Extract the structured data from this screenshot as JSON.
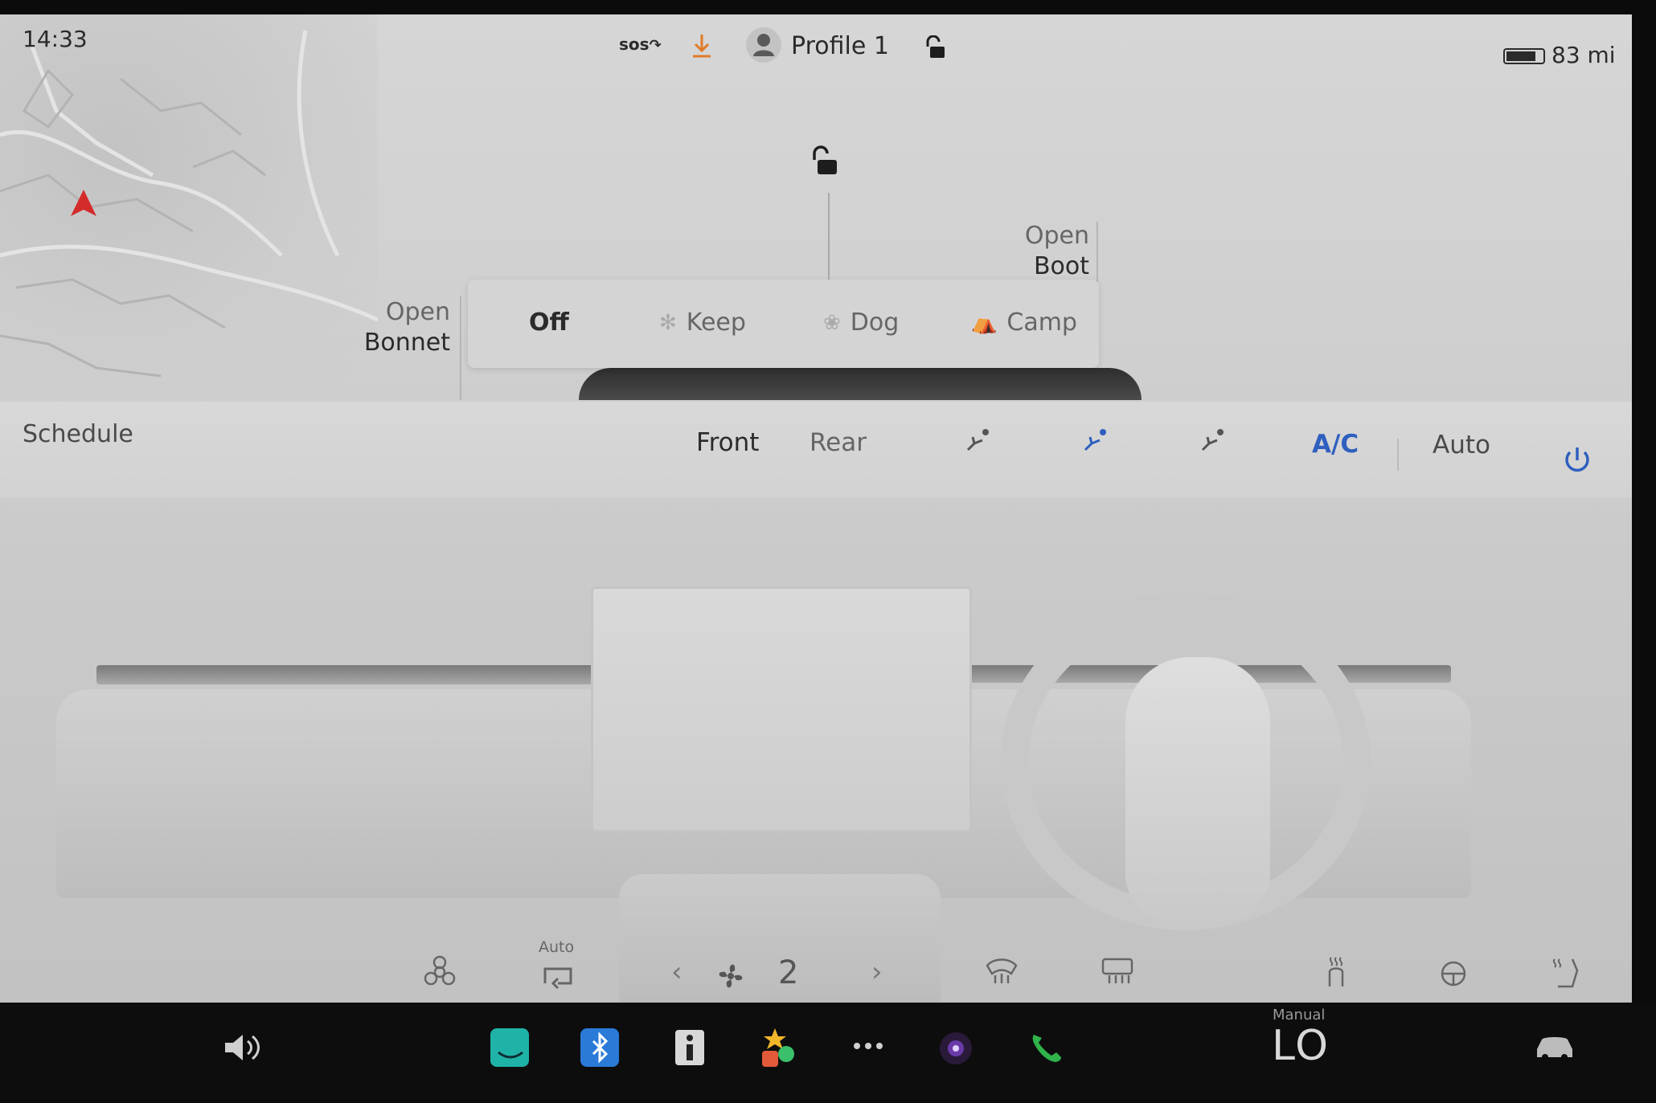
{
  "status": {
    "time": "14:33",
    "sos_label": "sos",
    "profile_name": "Profile 1",
    "range": "83 mi"
  },
  "car": {
    "open_bonnet_line1": "Open",
    "open_bonnet_line2": "Bonnet",
    "open_boot_line1": "Open",
    "open_boot_line2": "Boot"
  },
  "climate_modes": [
    {
      "label": "Off",
      "active": true
    },
    {
      "label": "Keep",
      "active": false
    },
    {
      "label": "Dog",
      "active": false
    },
    {
      "label": "Camp",
      "active": false
    }
  ],
  "climate": {
    "schedule_label": "Schedule",
    "tab_front": "Front",
    "tab_rear": "Rear",
    "ac_label": "A/C",
    "auto_label": "Auto",
    "recirc_auto_label": "Auto",
    "fan_speed": "2"
  },
  "dock": {
    "temp_mode_label": "Manual",
    "temp_value": "LO"
  },
  "colors": {
    "accent_blue": "#2f5fbf",
    "nav_arrow": "#d42b2b",
    "download_orange": "#e07b2a",
    "phone_green": "#2fb34a"
  }
}
